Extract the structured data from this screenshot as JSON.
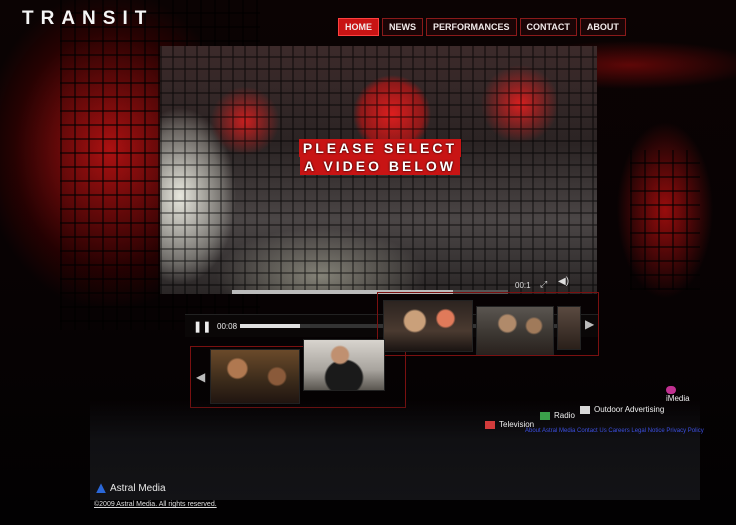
{
  "brand": {
    "logo": "TRANSIT"
  },
  "nav": [
    {
      "label": "HOME",
      "active": true
    },
    {
      "label": "NEWS",
      "active": false
    },
    {
      "label": "PERFORMANCES",
      "active": false
    },
    {
      "label": "CONTACT",
      "active": false
    },
    {
      "label": "ABOUT",
      "active": false
    }
  ],
  "player": {
    "overlay_line1": "PLEASE SELECT",
    "overlay_line2": "A VIDEO BELOW",
    "time_elapsed": "00:08",
    "time_right": "00:1",
    "play_icon": "pause-icon",
    "fullscreen_icon": "fullscreen-icon",
    "volume_icon": "volume-icon",
    "progress": 0.18
  },
  "thumbnails": {
    "strip_top": [
      "thumb-1",
      "thumb-2",
      "thumb-3"
    ],
    "strip_bottom": [
      "thumb-4",
      "thumb-5",
      "thumb-6",
      "thumb-7"
    ],
    "prev_icon": "chevron-left-icon",
    "next_icon": "chevron-right-icon"
  },
  "footer": {
    "television": "Television",
    "radio": "Radio",
    "outdoor": "Outdoor Advertising",
    "imedia": "iMedia",
    "links": "About Astral Media   Contact Us   Careers   Legal Notice   Privacy Policy",
    "astral_logo": "Astral Media",
    "copyright": "©2009 Astral Media. All rights reserved.",
    "colors": {
      "television": "#d23b3b",
      "radio": "#3aa04a",
      "outdoor": "#d8d8d8",
      "imedia": "#c03090"
    }
  },
  "colors": {
    "accent": "#c81414",
    "background": "#050203"
  }
}
